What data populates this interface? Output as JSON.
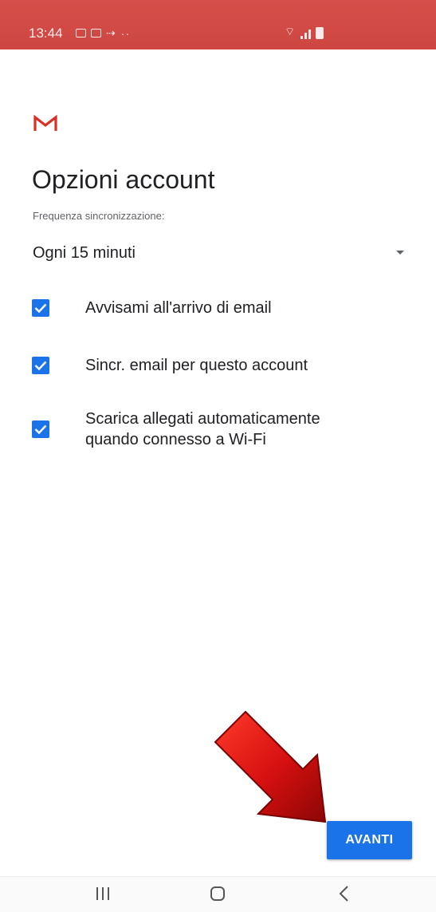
{
  "status_bar": {
    "time": "13:44",
    "background_color": "#cf4641",
    "left_icons": [
      "gallery-icon",
      "photo-icon",
      "transfer-icon",
      "more-notifications-icon"
    ],
    "right_icons": [
      "wifi-icon",
      "signal-icon",
      "battery-icon"
    ]
  },
  "header": {
    "logo_icon": "gmail-logo-icon",
    "title": "Opzioni account"
  },
  "sync": {
    "label": "Frequenza sincronizzazione:",
    "selected_value": "Ogni 15 minuti"
  },
  "options": [
    {
      "label": "Avvisami all'arrivo di email",
      "checked": true
    },
    {
      "label": "Sincr. email per questo account",
      "checked": true
    },
    {
      "label_line1": "Scarica allegati automaticamente",
      "label_line2": "quando connesso a Wi-Fi",
      "checked": true
    }
  ],
  "actions": {
    "next_label": "AVANTI",
    "accent_color": "#1a73e8"
  },
  "annotation": {
    "arrow_icon": "red-arrow-icon",
    "arrow_color": "#d01010"
  },
  "nav_bar": {
    "icons": [
      "recents-icon",
      "home-icon",
      "back-icon"
    ]
  }
}
